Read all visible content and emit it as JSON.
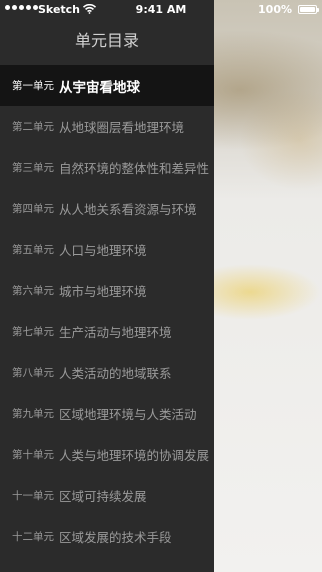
{
  "status_bar": {
    "carrier": "Sketch",
    "time": "9:41 AM",
    "battery": "100%"
  },
  "drawer": {
    "title": "单元目录",
    "active_index": 0,
    "items": [
      {
        "unit": "第一单元",
        "title": "从宇宙看地球"
      },
      {
        "unit": "第二单元",
        "title": "从地球圈层看地理环境"
      },
      {
        "unit": "第三单元",
        "title": "自然环境的整体性和差异性"
      },
      {
        "unit": "第四单元",
        "title": "从人地关系看资源与环境"
      },
      {
        "unit": "第五单元",
        "title": "人口与地理环境"
      },
      {
        "unit": "第六单元",
        "title": "城市与地理环境"
      },
      {
        "unit": "第七单元",
        "title": "生产活动与地理环境"
      },
      {
        "unit": "第八单元",
        "title": "人类活动的地域联系"
      },
      {
        "unit": "第九单元",
        "title": "区域地理环境与人类活动"
      },
      {
        "unit": "第十单元",
        "title": "人类与地理环境的协调发展"
      },
      {
        "unit": "十一单元",
        "title": "区域可持续发展"
      },
      {
        "unit": "十二单元",
        "title": "区域发展的技术手段"
      }
    ]
  },
  "icons": {
    "signal": "signal-dots-icon",
    "wifi": "wifi-icon",
    "battery": "battery-icon"
  }
}
